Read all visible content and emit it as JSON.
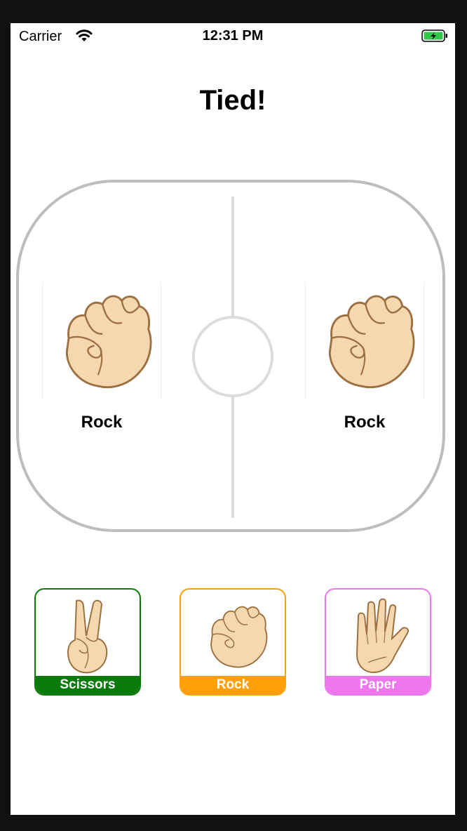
{
  "status_bar": {
    "carrier": "Carrier",
    "time": "12:31 PM",
    "icons": [
      "wifi-icon",
      "battery-charging-icon"
    ]
  },
  "result": {
    "title": "Tied!"
  },
  "arena": {
    "player_hand": {
      "label": "Rock",
      "icon": "rock-fist-icon"
    },
    "opponent_hand": {
      "label": "Rock",
      "icon": "rock-fist-icon"
    }
  },
  "choices": [
    {
      "label": "Scissors",
      "icon": "scissors-hand-icon",
      "color": "#0a7a0a"
    },
    {
      "label": "Rock",
      "icon": "rock-fist-icon",
      "color": "#ff9f0a"
    },
    {
      "label": "Paper",
      "icon": "paper-hand-icon",
      "color": "#ee77ee"
    }
  ],
  "colors": {
    "skin": "#f6d8b0",
    "outline": "#9c7040",
    "arena_border": "#bdbdbd",
    "midline": "#dcdcdc"
  }
}
